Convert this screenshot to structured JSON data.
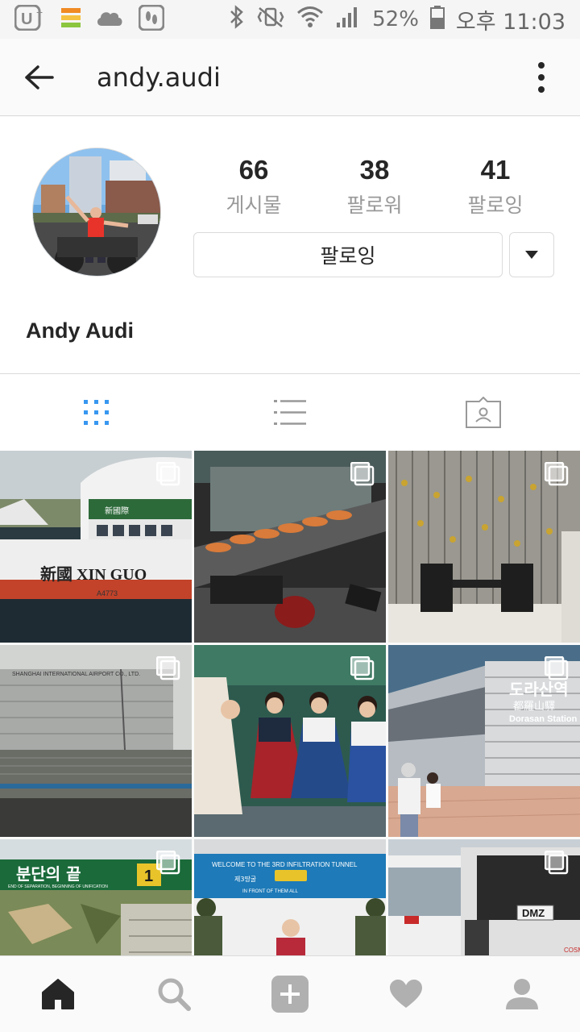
{
  "status_bar": {
    "battery_percent": "52%",
    "time": "오후 11:03"
  },
  "header": {
    "username": "andy.audi"
  },
  "profile": {
    "stats": [
      {
        "value": "66",
        "label": "게시물"
      },
      {
        "value": "38",
        "label": "팔로워"
      },
      {
        "value": "41",
        "label": "팔로잉"
      }
    ],
    "follow_button": "팔로잉",
    "display_name": "Andy Audi"
  },
  "grid": {
    "posts": [
      {
        "caption": "新國 XIN GUO",
        "subcaption": "A4773",
        "brand": "新國際"
      },
      {
        "caption": "",
        "subcaption": "",
        "brand": ""
      },
      {
        "caption": "",
        "subcaption": "",
        "brand": ""
      },
      {
        "caption": "SHANGHAI INTERNATIONAL AIRPORT CO., LTD.",
        "subcaption": "",
        "brand": ""
      },
      {
        "caption": "",
        "subcaption": "",
        "brand": ""
      },
      {
        "caption": "도라산역",
        "subcaption": "都羅山驛",
        "brand": "Dorasan Station"
      },
      {
        "caption": "분단의 끝",
        "subcaption": "END OF SEPARATION, BEGINNING OF UNIFICATION",
        "brand": "1"
      },
      {
        "caption": "WELCOME TO THE 3RD INFILTRATION TUNNEL",
        "subcaption": "IN FRONT OF THEM ALL",
        "brand": "제3땅굴"
      },
      {
        "caption": "DMZ",
        "subcaption": "",
        "brand": "COSM"
      }
    ]
  },
  "colors": {
    "accent_blue": "#3897f0",
    "icon_gray": "#999999",
    "nav_active": "#262626"
  },
  "icons": {
    "back": "arrow-left-icon",
    "more": "vertical-dots-icon",
    "grid_tab": "grid-icon",
    "list_tab": "list-icon",
    "tagged_tab": "tagged-person-icon",
    "home": "home-icon",
    "search": "search-icon",
    "add": "add-post-icon",
    "activity": "heart-icon",
    "profile": "profile-icon"
  }
}
